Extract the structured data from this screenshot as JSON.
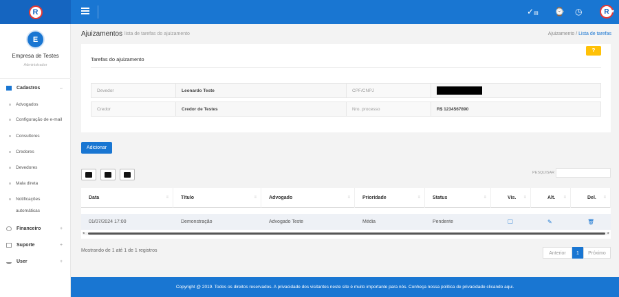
{
  "header": {
    "icons": [
      "check-flag-icon",
      "watch-icon",
      "clock-icon"
    ]
  },
  "sidebar": {
    "avatar_letter": "E",
    "company": "Empresa de Testes",
    "role": "Administrador",
    "sections": [
      {
        "label": "Cadastros",
        "chevron": "–"
      },
      {
        "label": "Financeiro",
        "chevron": "+"
      },
      {
        "label": "Suporte",
        "chevron": "+"
      },
      {
        "label": "User",
        "chevron": "+"
      }
    ],
    "cadastros_items": [
      "Advogados",
      "Configuração de e-mail",
      "Consultores",
      "Credores",
      "Devedores",
      "Mala direta",
      "Notificações",
      "automáticas"
    ]
  },
  "page": {
    "title": "Ajuizamentos",
    "subtitle": "lista de tarefas do ajuizamento",
    "breadcrumb": {
      "first": "Ajuizamento",
      "sep": "/",
      "active": "Lista de tarefas"
    }
  },
  "card": {
    "title": "Tarefas do ajuizamento",
    "help_label": "?",
    "rows": [
      {
        "l1": "Devedor",
        "v1": "Leonardo Teste",
        "l2": "CPF/CNPJ",
        "v2": ""
      },
      {
        "l1": "Credor",
        "v1": "Credor de Testes",
        "l2": "Nro. processo",
        "v2": "R$ 1234567890"
      }
    ]
  },
  "add_button": "Adicionar",
  "search": {
    "label": "PESQUISAR",
    "value": ""
  },
  "table": {
    "columns": [
      "Data",
      "Título",
      "Advogado",
      "Prioridade",
      "Status",
      "Vis.",
      "Alt.",
      "Del."
    ],
    "rows": [
      {
        "data": "01/07/2024 17:00",
        "titulo": "Demonstração",
        "advogado": "Advogado Teste",
        "prioridade": "Média",
        "status": "Pendente"
      }
    ]
  },
  "footer_info": "Mostrando de 1 até 1 de 1 registros",
  "pagination": {
    "prev": "Anterior",
    "page": "1",
    "next": "Próximo"
  },
  "footer": "Copyright @ 2019. Todos os direitos reservados. A privacidade dos visitantes neste site é muito importante para nós. Conheça nossa política de privacidade clicando aqui.",
  "colors": {
    "primary": "#1976d2",
    "warning": "#ffc107",
    "logo_ring": "#e53935"
  }
}
